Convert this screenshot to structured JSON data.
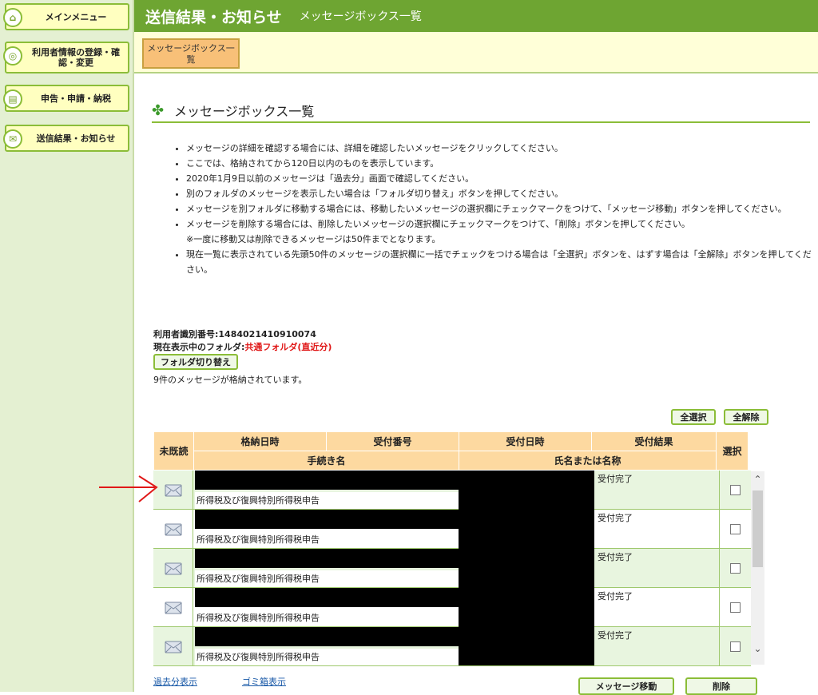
{
  "sidebar": {
    "items": [
      {
        "label": "メインメニュー",
        "icon": "home-icon"
      },
      {
        "label": "利用者情報の登録・確認・変更",
        "icon": "user-settings-icon"
      },
      {
        "label": "申告・申請・納税",
        "icon": "document-icon"
      },
      {
        "label": "送信結果・お知らせ",
        "icon": "mail-icon"
      }
    ]
  },
  "header": {
    "title": "送信結果・お知らせ",
    "subtitle": "メッセージボックス一覧"
  },
  "tab": {
    "label": "メッセージボックス一覧"
  },
  "page_title": "メッセージボックス一覧",
  "notes": [
    "メッセージの詳細を確認する場合には、詳細を確認したいメッセージをクリックしてください。",
    "ここでは、格納されてから120日以内のものを表示しています。",
    "2020年1月9日以前のメッセージは「過去分」画面で確認してください。",
    "別のフォルダのメッセージを表示したい場合は「フォルダ切り替え」ボタンを押してください。",
    "メッセージを別フォルダに移動する場合には、移動したいメッセージの選択欄にチェックマークをつけて、「メッセージ移動」ボタンを押してください。",
    "メッセージを削除する場合には、削除したいメッセージの選択欄にチェックマークをつけて、「削除」ボタンを押してください。",
    "現在一覧に表示されている先頭50件のメッセージの選択欄に一括でチェックをつける場合は「全選択」ボタンを、はずす場合は「全解除」ボタンを押してください。"
  ],
  "note_sub": "※一度に移動又は削除できるメッセージは50件までとなります。",
  "info": {
    "user_id_label": "利用者識別番号:",
    "user_id": "1484021410910074",
    "folder_label": "現在表示中のフォルダ:",
    "folder": "共通フォルダ(直近分)",
    "switch_button": "フォルダ切り替え",
    "count_text": "9件のメッセージが格納されています。"
  },
  "buttons": {
    "select_all": "全選択",
    "deselect_all": "全解除",
    "move": "メッセージ移動",
    "delete": "削除"
  },
  "table": {
    "headers": {
      "unread": "未既読",
      "stored_date": "格納日時",
      "receipt_no": "受付番号",
      "received_date": "受付日時",
      "result": "受付結果",
      "procedure": "手続き名",
      "name": "氏名または名称",
      "select": "選択"
    },
    "rows": [
      {
        "result": "受付完了",
        "procedure": "所得税及び復興特別所得税申告"
      },
      {
        "result": "受付完了",
        "procedure": "所得税及び復興特別所得税申告"
      },
      {
        "result": "受付完了",
        "procedure": "所得税及び復興特別所得税申告"
      },
      {
        "result": "受付完了",
        "procedure": "所得税及び復興特別所得税申告"
      },
      {
        "result": "受付完了",
        "procedure": "所得税及び復興特別所得税申告"
      }
    ]
  },
  "links": {
    "past": "過去分表示",
    "trash": "ゴミ箱表示"
  },
  "colors": {
    "brand_green": "#6ea532",
    "header_orange": "#fdd9a0",
    "row_green": "#e8f5df",
    "red_text": "#e01818"
  }
}
